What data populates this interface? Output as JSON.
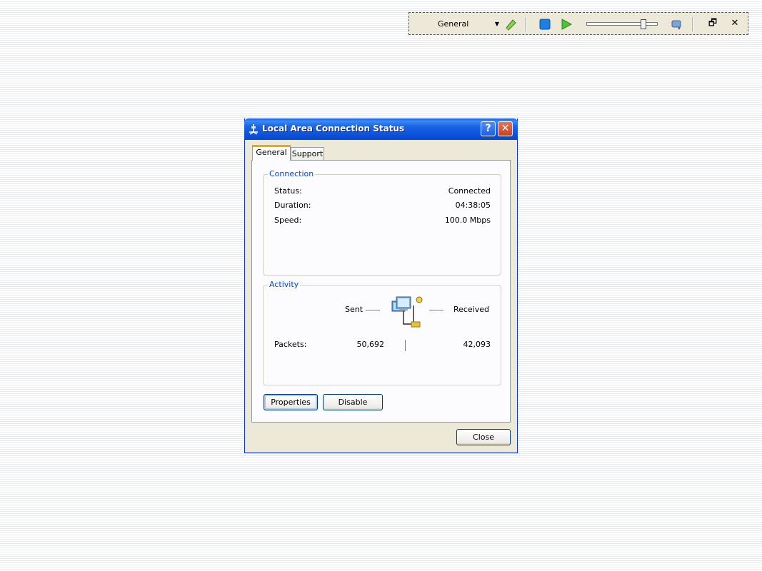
{
  "toolbar": {
    "profile_value": "General",
    "slider_position": 0.8
  },
  "window": {
    "title": "Local Area Connection Status",
    "help_label": "?",
    "close_label": "✕"
  },
  "tabs": [
    {
      "label": "General",
      "selected": true
    },
    {
      "label": "Support",
      "selected": false
    }
  ],
  "connection": {
    "legend": "Connection",
    "rows": [
      {
        "label": "Status:",
        "value": "Connected"
      },
      {
        "label": "Duration:",
        "value": "04:38:05"
      },
      {
        "label": "Speed:",
        "value": "100.0 Mbps"
      }
    ]
  },
  "activity": {
    "legend": "Activity",
    "sent_label": "Sent",
    "received_label": "Received",
    "packets_label": "Packets:",
    "packets_sent": "50,692",
    "packets_received": "42,093"
  },
  "buttons": {
    "properties": "Properties",
    "disable": "Disable",
    "close": "Close"
  },
  "icons": {
    "network": "network-connection-icon",
    "pencil": "pencil-icon",
    "stop": "stop-icon",
    "play": "play-icon",
    "speaker": "speaker-icon",
    "restore": "restore-icon",
    "close": "close-icon"
  }
}
